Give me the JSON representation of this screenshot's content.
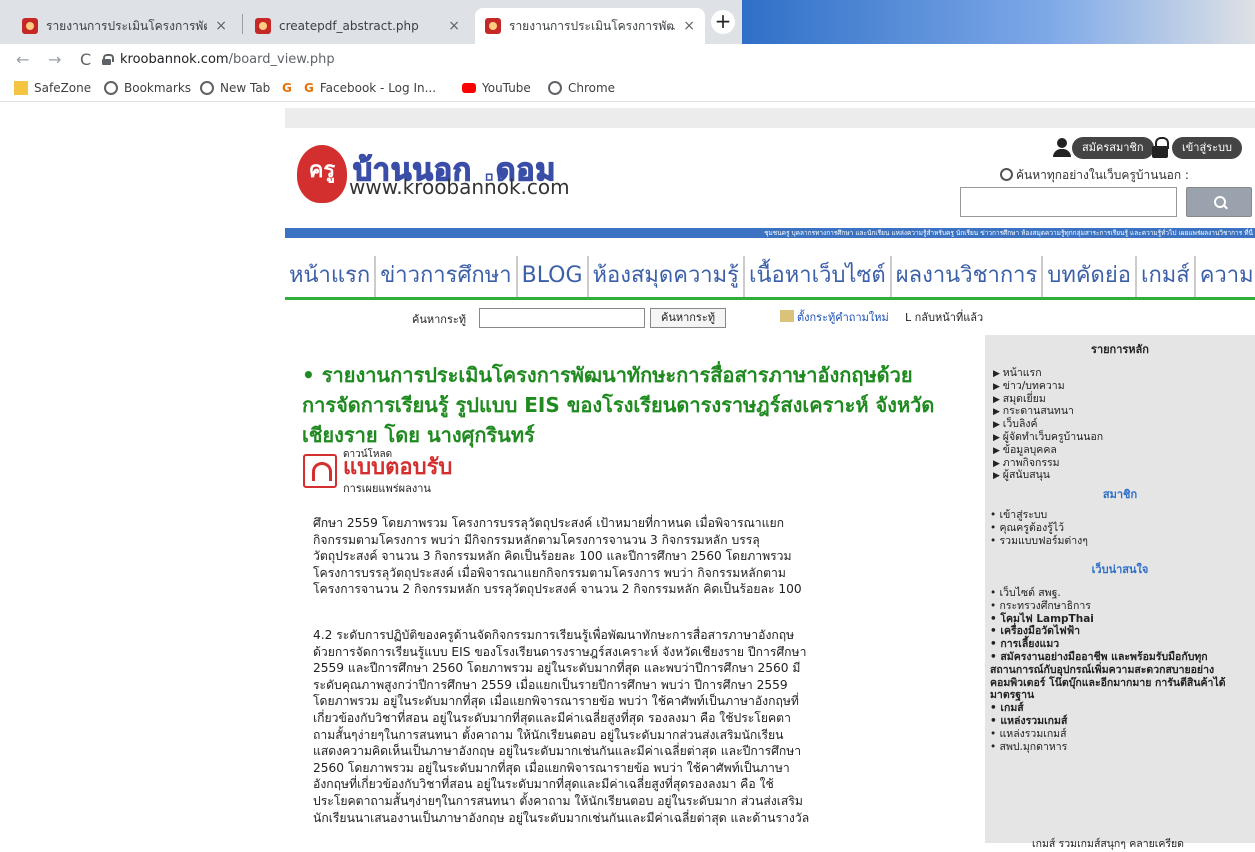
{
  "browser": {
    "tabs": [
      {
        "title": "รายงานการประเมินโครงการพัฒนาทั",
        "close": "×"
      },
      {
        "title": "createpdf_abstract.php",
        "close": "×"
      },
      {
        "title": "รายงานการประเมินโครงการพัฒนาท",
        "close": "×"
      }
    ],
    "new_tab": "+",
    "back": "←",
    "forward": "→",
    "reload": "C",
    "url_host": "kroobannok.com",
    "url_path": "/board_view.php",
    "bookmarks": [
      "SafeZone",
      "Bookmarks",
      "New Tab",
      "G",
      "Facebook - Log In...",
      "YouTube",
      "Chrome"
    ]
  },
  "header": {
    "logo_badge": "ครู",
    "logo_thai": "บ้านนอก .ดอม",
    "logo_url": "www.kroobannok.com",
    "register_label": "สมัครสมาชิก",
    "login_label": "เข้าสู่ระบบ",
    "search_hint": "ค้นหาทุกอย่างในเว็บครูบ้านนอก :",
    "ticker": "ชุมชนครู บุคลากรทางการศึกษา และนักเรียน แหล่งความรู้สำหรับครู นักเรียน ข่าวการศึกษา ห้องสมุดความรู้ทุกกลุ่มสาระการเรียนรู้ และความรู้ทั่วไป เผยแพร่ผลงานวิชาการ ที่นี่"
  },
  "nav": [
    "หน้าแรก",
    "ข่าวการศึกษา",
    "BLOG",
    "ห้องสมุดความรู้",
    "เนื้อหาเว็บไซต์",
    "ผลงานวิชาการ",
    "บทคัดย่อ",
    "เกมส์",
    "ความรู้ทั่วไป"
  ],
  "board": {
    "search_label": "ค้นหากระทู้",
    "search_button": "ค้นหากระทู้",
    "new_question": "ตั้งกระทู้คำถามใหม่",
    "back": "L กลับหน้าที่แล้ว"
  },
  "article": {
    "title": "• รายงานการประเมินโครงการพัฒนาทักษะการสื่อสารภาษาอังกฤษด้วยการจัดการเรียนรู้ รูปแบบ EIS ของโรงเรียนดารงราษฎร์สงเคราะห์ จังหวัดเชียงราย โดย นางศุกรินทร์",
    "download_small": "ดาวน์โหลด",
    "download_big": "แบบตอบรับ",
    "download_sub": "การเผยแพร่ผลงาน",
    "paragraphs": [
      [
        "ศึกษา 2559 โดยภาพรวม โครงการบรรลุวัตถุประสงค์ เป้าหมายที่กาหนด เมื่อพิจารณาแยก",
        "กิจกรรมตามโครงการ พบว่า มีกิจกรรมหลักตามโครงการจานวน 3 กิจกรรมหลัก บรรลุ",
        "วัตถุประสงค์ จานวน 3 กิจกรรมหลัก คิดเป็นร้อยละ 100 และปีการศึกษา 2560 โดยภาพรวม",
        "โครงการบรรลุวัตถุประสงค์ เมื่อพิจารณาแยกกิจกรรมตามโครงการ พบว่า กิจกรรมหลักตาม",
        "โครงการจานวน 2 กิจกรรมหลัก บรรลุวัตถุประสงค์ จานวน 2 กิจกรรมหลัก คิดเป็นร้อยละ 100"
      ],
      [
        "4.2 ระดับการปฏิบัติของครูด้านจัดกิจกรรมการเรียนรู้เพื่อพัฒนาทักษะการสื่อสารภาษาอังกฤษ",
        "ด้วยการจัดการเรียนรู้แบบ EIS ของโรงเรียนดารงราษฎร์สงเคราะห์ จังหวัดเชียงราย ปีการศึกษา",
        "2559 และปีการศึกษา 2560 โดยภาพรวม อยู่ในระดับมากที่สุด และพบว่าปีการศึกษา 2560 มี",
        "ระดับคุณภาพสูงกว่าปีการศึกษา 2559 เมื่อแยกเป็นรายปีการศึกษา พบว่า ปีการศึกษา 2559",
        "โดยภาพรวม อยู่ในระดับมากที่สุด เมื่อแยกพิจารณารายข้อ พบว่า ใช้คาศัพท์เป็นภาษาอังกฤษที่",
        "เกี่ยวข้องกับวิชาที่สอน อยู่ในระดับมากที่สุดและมีค่าเฉลี่ยสูงที่สุด รองลงมา คือ ใช้ประโยคตา",
        "ถามสั้นๆง่ายๆในการสนทนา ตั้งคาถาม ให้นักเรียนตอบ อยู่ในระดับมากส่วนส่งเสริมนักเรียน",
        "แสดงความคิดเห็นเป็นภาษาอังกฤษ อยู่ในระดับมากเช่นกันและมีค่าเฉลี่ยต่าสุด และปีการศึกษา",
        "2560 โดยภาพรวม อยู่ในระดับมากที่สุด เมื่อแยกพิจารณารายข้อ พบว่า ใช้คาศัพท์เป็นภาษา",
        "อังกฤษที่เกี่ยวข้องกับวิชาที่สอน อยู่ในระดับมากที่สุดและมีค่าเฉลี่ยสูงที่สุดรองลงมา คือ ใช้",
        "ประโยคตาถามสั้นๆง่ายๆในการสนทนา ตั้งคาถาม ให้นักเรียนตอบ อยู่ในระดับมาก ส่วนส่งเสริม",
        "นักเรียนนาเสนองานเป็นภาษาอังกฤษ อยู่ในระดับมากเช่นกันและมีค่าเฉลี่ยต่าสุด และด้านรางวัล"
      ]
    ]
  },
  "sidebar": {
    "main_title": "รายการหลัก",
    "main_items": [
      "หน้าแรก",
      "ข่าว/บทความ",
      "สมุดเยี่ยม",
      "กระดานสนทนา",
      "เว็บลิงค์",
      "ผู้จัดทำเว็บครูบ้านนอก",
      "ข้อมูลบุคคล",
      "ภาพกิจกรรม",
      "ผู้สนับสนุน"
    ],
    "member_title": "สมาชิก",
    "member_items": [
      "• เข้าสู่ระบบ",
      "• คุณครูต้องรู้ไว้",
      "• รวมแบบฟอร์มต่างๆ"
    ],
    "interest_title": "เว็บน่าสนใจ",
    "interest_items": [
      {
        "text": "• เว็บไซต์ สพฐ.",
        "bold": false
      },
      {
        "text": "• กระทรวงศึกษาธิการ",
        "bold": false
      },
      {
        "text": "• โคมไฟ LampThai",
        "bold": true
      },
      {
        "text": "• เครื่องมือวัดไฟฟ้า",
        "bold": true
      },
      {
        "text": "• การเลี้ยงแมว",
        "bold": true
      },
      {
        "text": "• สมัครงานอย่างมืออาชีพ และพร้อมรับมือกับทุกสถานการณ์กับอุปกรณ์เพิ่มความสะดวกสบายอย่าง คอมพิวเตอร์ โน๊ตบุ๊กและอีกมากมาย การันตีสินค้าได้มาตรฐาน",
        "bold": true
      },
      {
        "text": "• เกมส์",
        "bold": true
      },
      {
        "text": "• แหล่งรวมเกมส์",
        "bold": true
      },
      {
        "text": "• แหล่งรวมเกมส์",
        "bold": false
      },
      {
        "text": "• สพป.มุกดาหาร",
        "bold": false
      }
    ],
    "footer": "เกมส์ รวมเกมส์สนุกๆ คลายเครียด"
  }
}
